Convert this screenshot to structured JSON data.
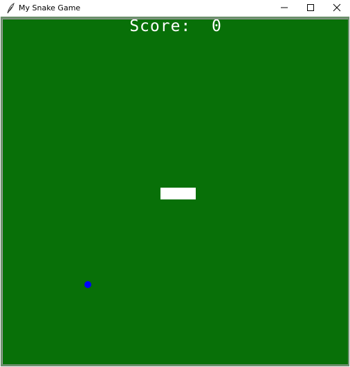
{
  "window": {
    "title": "My Snake Game"
  },
  "icons": {
    "app": "feather-icon",
    "minimize": "minimize-icon",
    "maximize": "maximize-icon",
    "close": "close-icon"
  },
  "game": {
    "score_label": "Score:",
    "score_value": "0",
    "score_text": "Score:  0",
    "colors": {
      "background": "#087008",
      "snake": "#ffffff",
      "food": "#0000ff",
      "score_text": "#ffffff"
    }
  }
}
